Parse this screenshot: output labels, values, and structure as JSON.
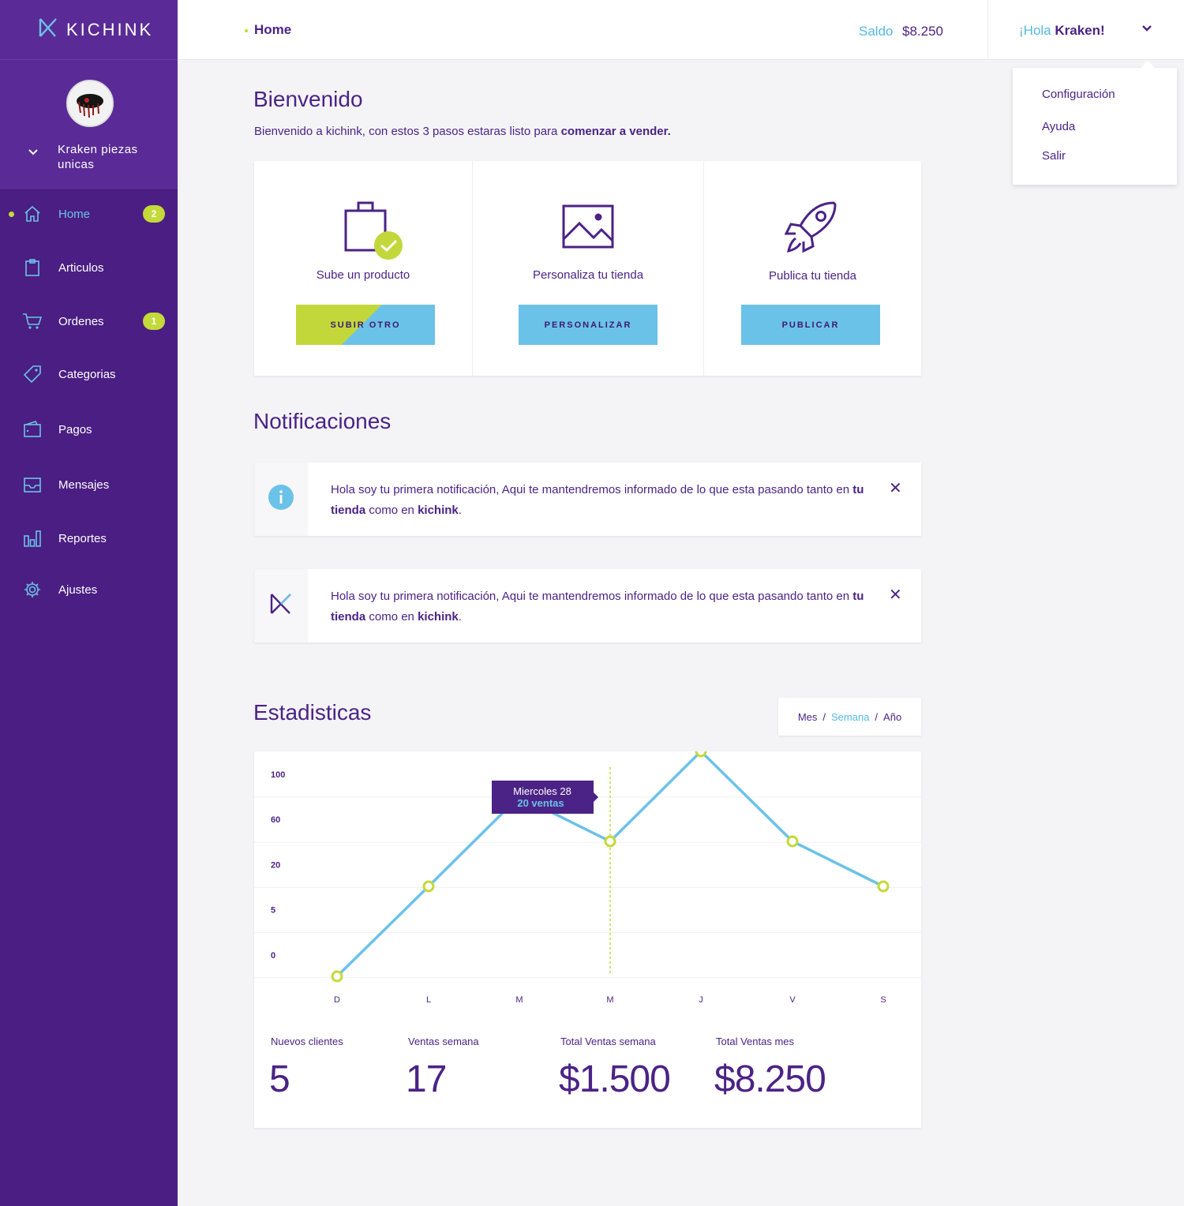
{
  "brand": {
    "name": "KICHINK"
  },
  "profile": {
    "store_name": "Kraken piezas unicas"
  },
  "sidebar": {
    "items": [
      {
        "label": "Home",
        "badge": "2"
      },
      {
        "label": "Articulos"
      },
      {
        "label": "Ordenes",
        "badge": "1"
      },
      {
        "label": "Categorias"
      },
      {
        "label": "Pagos"
      },
      {
        "label": "Mensajes"
      },
      {
        "label": "Reportes"
      },
      {
        "label": "Ajustes"
      }
    ],
    "active": "Home"
  },
  "topbar": {
    "breadcrumb": "Home",
    "saldo_label": "Saldo",
    "saldo_value": "$8.250",
    "greeting_prefix": "¡Hola",
    "greeting_name": "Kraken!"
  },
  "user_menu": {
    "items": [
      "Configuración",
      "Ayuda",
      "Salir"
    ]
  },
  "welcome": {
    "title": "Bienvenido",
    "intro_text": "Bienvenido a kichink, con estos 3 pasos estaras listo para",
    "intro_bold": "comenzar a vender.",
    "steps": [
      {
        "label": "Sube un producto",
        "button": "SUBIR OTRO"
      },
      {
        "label": "Personaliza tu tienda",
        "button": "PERSONALIZAR"
      },
      {
        "label": "Publica tu tienda",
        "button": "PUBLICAR"
      }
    ]
  },
  "notifications": {
    "title": "Notificaciones",
    "items": [
      {
        "text_1": "Hola soy tu primera notificación, Aqui te mantendremos informado de lo que esta pasando tanto en",
        "bold_1": "tu tienda",
        "text_2": "como en",
        "bold_2": "kichink",
        "text_3": "."
      },
      {
        "text_1": "Hola soy tu primera notificación, Aqui te mantendremos informado de lo que esta pasando tanto en",
        "bold_1": "tu tienda",
        "text_2": "como en",
        "bold_2": "kichink",
        "text_3": "."
      }
    ],
    "close_label": "✕"
  },
  "stats": {
    "title": "Estadisticas",
    "periods": [
      "Mes",
      "Semana",
      "Año"
    ],
    "period_separator": "/",
    "selected_period": "Semana",
    "tooltip": {
      "title": "Miercoles 28",
      "value": "20 ventas"
    },
    "kpis": [
      {
        "label": "Nuevos clientes",
        "value": "5"
      },
      {
        "label": "Ventas semana",
        "value": "17"
      },
      {
        "label": "Total Ventas semana",
        "value": "$1.500"
      },
      {
        "label": "Total Ventas mes",
        "value": "$8.250"
      }
    ]
  },
  "chart_data": {
    "type": "line",
    "categories": [
      "D",
      "L",
      "M",
      "M",
      "J",
      "V",
      "S"
    ],
    "y_ticks": [
      "100",
      "60",
      "20",
      "5",
      "0"
    ],
    "series": [
      {
        "values": [
          -1,
          1,
          3,
          2,
          4,
          2,
          1
        ]
      }
    ],
    "y_scale": "ordinal-ticks",
    "highlight_index": 3,
    "grid": true,
    "colors": {
      "line": "#6bc2e8",
      "points": "#c4d93a",
      "highlight": "#c4d93a"
    }
  },
  "colors": {
    "sidebar": "#4a1e82",
    "accent": "#55b9e2",
    "lime": "#c4d93a",
    "text": "#4b2386"
  }
}
